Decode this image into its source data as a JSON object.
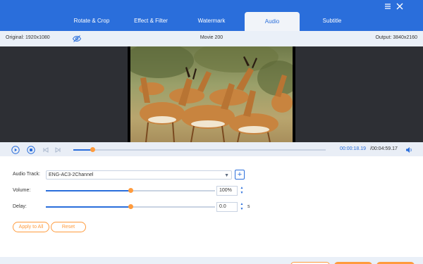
{
  "tabs": [
    {
      "label": "Rotate & Crop",
      "active": false
    },
    {
      "label": "Effect & Filter",
      "active": false
    },
    {
      "label": "Watermark",
      "active": false
    },
    {
      "label": "Audio",
      "active": true
    },
    {
      "label": "Subtitle",
      "active": false
    }
  ],
  "window": {
    "menu_icon": "menu-icon",
    "close_icon": "close-icon"
  },
  "info": {
    "original": "Original: 1920x1080",
    "title": "Movie 200",
    "output": "Output: 3840x2160"
  },
  "player": {
    "progress_fraction": 0.077,
    "current_time": "00:00:18.19",
    "total_time": "/00:04:59.17"
  },
  "audio": {
    "audio_track_label": "Audio Track:",
    "audio_track_value": "ENG-AC3-2Channel",
    "volume_label": "Volume:",
    "volume_value": "100%",
    "volume_fraction": 0.5,
    "delay_label": "Delay:",
    "delay_value": "0.0",
    "delay_fraction": 0.5,
    "delay_unit": "s"
  },
  "buttons": {
    "apply_all": "Apply to All",
    "reset": "Reset"
  },
  "colors": {
    "accent": "#2a6edb",
    "orange": "#ff9b3d",
    "video_bg": "#2d2f34"
  }
}
